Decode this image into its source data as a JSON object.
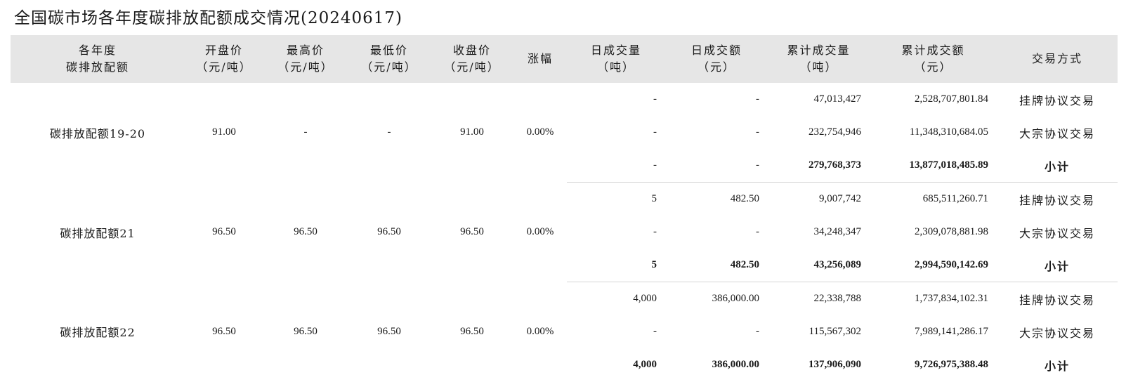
{
  "title": "全国碳市场各年度碳排放配额成交情况(20240617)",
  "headers": [
    {
      "l1": "各年度",
      "l2": "碳排放配额"
    },
    {
      "l1": "开盘价",
      "l2": "（元/吨）"
    },
    {
      "l1": "最高价",
      "l2": "（元/吨）"
    },
    {
      "l1": "最低价",
      "l2": "（元/吨）"
    },
    {
      "l1": "收盘价",
      "l2": "（元/吨）"
    },
    {
      "l1": "涨幅",
      "l2": ""
    },
    {
      "l1": "日成交量",
      "l2": "（吨）"
    },
    {
      "l1": "日成交额",
      "l2": "（元）"
    },
    {
      "l1": "累计成交量",
      "l2": "（吨）"
    },
    {
      "l1": "累计成交额",
      "l2": "（元）"
    },
    {
      "l1": "交易方式",
      "l2": ""
    }
  ],
  "groups": [
    {
      "name": "碳排放配额19-20",
      "open": "91.00",
      "high": "-",
      "low": "-",
      "close": "91.00",
      "change": "0.00%",
      "rows": [
        {
          "dvol": "-",
          "damt": "-",
          "cvol": "47,013,427",
          "camt": "2,528,707,801.84",
          "type": "挂牌协议交易"
        },
        {
          "dvol": "-",
          "damt": "-",
          "cvol": "232,754,946",
          "camt": "11,348,310,684.05",
          "type": "大宗协议交易"
        },
        {
          "dvol": "-",
          "damt": "-",
          "cvol": "279,768,373",
          "camt": "13,877,018,485.89",
          "type": "小计"
        }
      ]
    },
    {
      "name": "碳排放配额21",
      "open": "96.50",
      "high": "96.50",
      "low": "96.50",
      "close": "96.50",
      "change": "0.00%",
      "rows": [
        {
          "dvol": "5",
          "damt": "482.50",
          "cvol": "9,007,742",
          "camt": "685,511,260.71",
          "type": "挂牌协议交易"
        },
        {
          "dvol": "-",
          "damt": "-",
          "cvol": "34,248,347",
          "camt": "2,309,078,881.98",
          "type": "大宗协议交易"
        },
        {
          "dvol": "5",
          "damt": "482.50",
          "cvol": "43,256,089",
          "camt": "2,994,590,142.69",
          "type": "小计"
        }
      ]
    },
    {
      "name": "碳排放配额22",
      "open": "96.50",
      "high": "96.50",
      "low": "96.50",
      "close": "96.50",
      "change": "0.00%",
      "rows": [
        {
          "dvol": "4,000",
          "damt": "386,000.00",
          "cvol": "22,338,788",
          "camt": "1,737,834,102.31",
          "type": "挂牌协议交易"
        },
        {
          "dvol": "-",
          "damt": "-",
          "cvol": "115,567,302",
          "camt": "7,989,141,286.17",
          "type": "大宗协议交易"
        },
        {
          "dvol": "4,000",
          "damt": "386,000.00",
          "cvol": "137,906,090",
          "camt": "9,726,975,388.48",
          "type": "小计"
        }
      ]
    }
  ]
}
